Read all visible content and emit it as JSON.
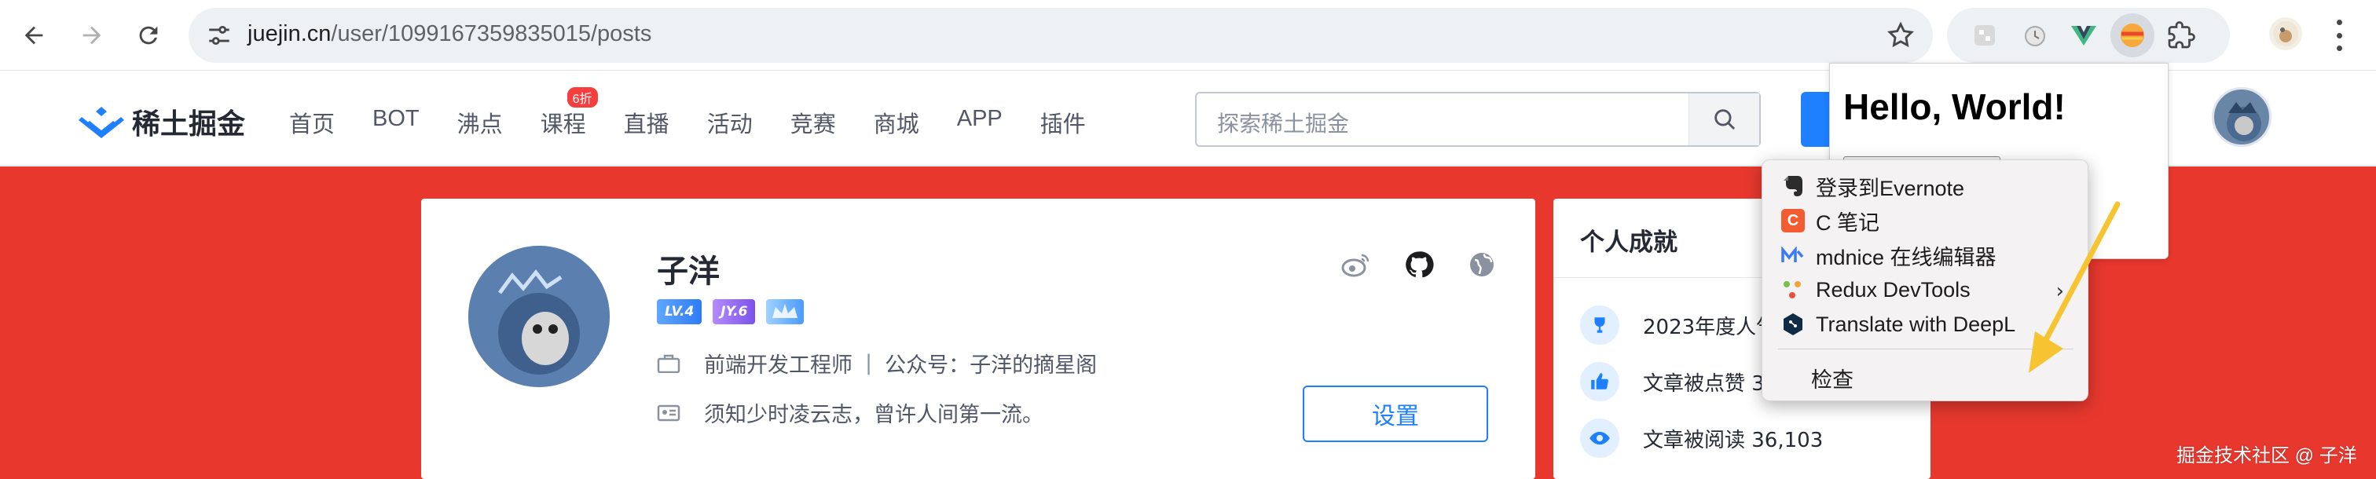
{
  "browser": {
    "url_host": "juejin.cn",
    "url_path": "/user/1099167359835015/posts"
  },
  "header": {
    "logo_text": "稀土掘金",
    "nav": [
      "首页",
      "BOT",
      "沸点",
      "课程",
      "直播",
      "活动",
      "竞赛",
      "商城",
      "APP",
      "插件"
    ],
    "course_badge": "6折",
    "search_placeholder": "探索稀土掘金"
  },
  "profile": {
    "name": "子洋",
    "badges": {
      "level": "LV.4",
      "jy": "JY.6"
    },
    "job": "前端开发工程师",
    "separator": "|",
    "wechat": "公众号：子洋的摘星阁",
    "bio": "须知少时凌云志，曾许人间第一流。",
    "settings_label": "设置"
  },
  "achievements": {
    "title": "个人成就",
    "items": [
      "2023年度人气",
      "文章被点赞 3",
      "文章被阅读 36,103"
    ]
  },
  "popup": {
    "heading": "Hello, World!"
  },
  "context_menu": {
    "items": [
      {
        "label": "登录到Evernote",
        "icon": "evernote-icon"
      },
      {
        "label": "C 笔记",
        "icon": "c-note-icon"
      },
      {
        "label": "mdnice 在线编辑器",
        "icon": "mdnice-icon"
      },
      {
        "label": "Redux DevTools",
        "icon": "redux-icon"
      },
      {
        "label": "Translate with DeepL",
        "icon": "deepl-icon"
      }
    ],
    "inspect": "检查",
    "submenu_arrow": "›"
  },
  "colors": {
    "brand_blue": "#1e80ff",
    "banner_red": "#e8382e",
    "deepl_navy": "#0f2b46",
    "c_note_orange": "#f35b30"
  },
  "watermark": "掘金技术社区 @ 子洋"
}
